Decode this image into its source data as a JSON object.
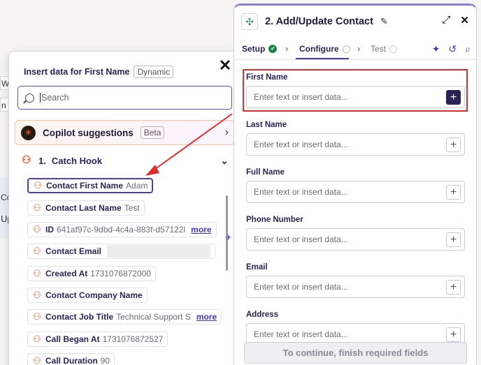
{
  "background": {
    "fragments": [
      "We",
      "n H",
      "Co",
      "Up"
    ]
  },
  "popup": {
    "title": "Insert data for First Name",
    "title_tag": "Dynamic",
    "close_glyph": "✕",
    "search_placeholder": "Search",
    "copilot": {
      "label": "Copilot suggestions",
      "badge": "Beta"
    },
    "step": {
      "number": "1.",
      "name": "Catch Hook"
    },
    "items": [
      {
        "name": "Contact First Name",
        "value": "Adam",
        "more": ""
      },
      {
        "name": "Contact Last Name",
        "value": "Test",
        "more": ""
      },
      {
        "name": "ID",
        "value": "641af97c-9dbd-4c4a-883f-d57122l",
        "more": "more"
      },
      {
        "name": "Contact Email",
        "value": "",
        "more": ""
      },
      {
        "name": "Created At",
        "value": "1731076872000",
        "more": ""
      },
      {
        "name": "Contact Company Name",
        "value": "",
        "more": ""
      },
      {
        "name": "Contact Job Title",
        "value": "Technical Support S",
        "more": "more"
      },
      {
        "name": "Call Began At",
        "value": "1731076872527",
        "more": ""
      },
      {
        "name": "Call Duration",
        "value": "90",
        "more": ""
      }
    ]
  },
  "panel": {
    "title": "2. Add/Update Contact",
    "tabs": {
      "setup": "Setup",
      "configure": "Configure",
      "test": "Test"
    },
    "fields": [
      {
        "label": "First Name",
        "placeholder": "Enter text or insert data..."
      },
      {
        "label": "Last Name",
        "placeholder": "Enter text or insert data..."
      },
      {
        "label": "Full Name",
        "placeholder": "Enter text or insert data..."
      },
      {
        "label": "Phone Number",
        "placeholder": "Enter text or insert data..."
      },
      {
        "label": "Email",
        "placeholder": "Enter text or insert data..."
      },
      {
        "label": "Address",
        "placeholder": "Enter text or insert data..."
      }
    ],
    "continue_label": "To continue, finish required fields"
  },
  "colors": {
    "accent": "#4437b9",
    "zapier_orange": "#e8582c",
    "highlight_red": "#e02e2e",
    "success": "#1b8a48"
  },
  "icons": {
    "step_app": "zap-icon",
    "copilot": "copilot-logo-icon"
  }
}
